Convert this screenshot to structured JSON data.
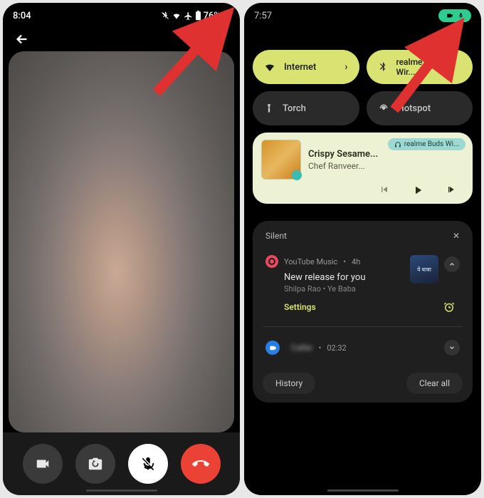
{
  "left": {
    "time": "8:04",
    "battery": "76%",
    "call": {
      "camera_label": "camera",
      "switch_label": "switch",
      "mute_label": "mute",
      "hangup_label": "hangup"
    }
  },
  "right": {
    "time": "7:57",
    "qs": {
      "internet": "Internet",
      "bluetooth": "realme Buds Wir...",
      "torch": "Torch",
      "hotspot": "Hotspot"
    },
    "media": {
      "title": "Crispy Sesame...",
      "artist": "Chef Ranveer...",
      "output": "realme Buds Wi..."
    },
    "notifs": {
      "section": "Silent",
      "yt": {
        "app": "YouTube Music",
        "age": "4h",
        "title": "New release for you",
        "sub": "Shilpa Rao • Ye Baba",
        "thumb_text": "ये बाबा",
        "action": "Settings"
      },
      "duo": {
        "time": "02:32"
      },
      "history": "History",
      "clear": "Clear all"
    }
  }
}
